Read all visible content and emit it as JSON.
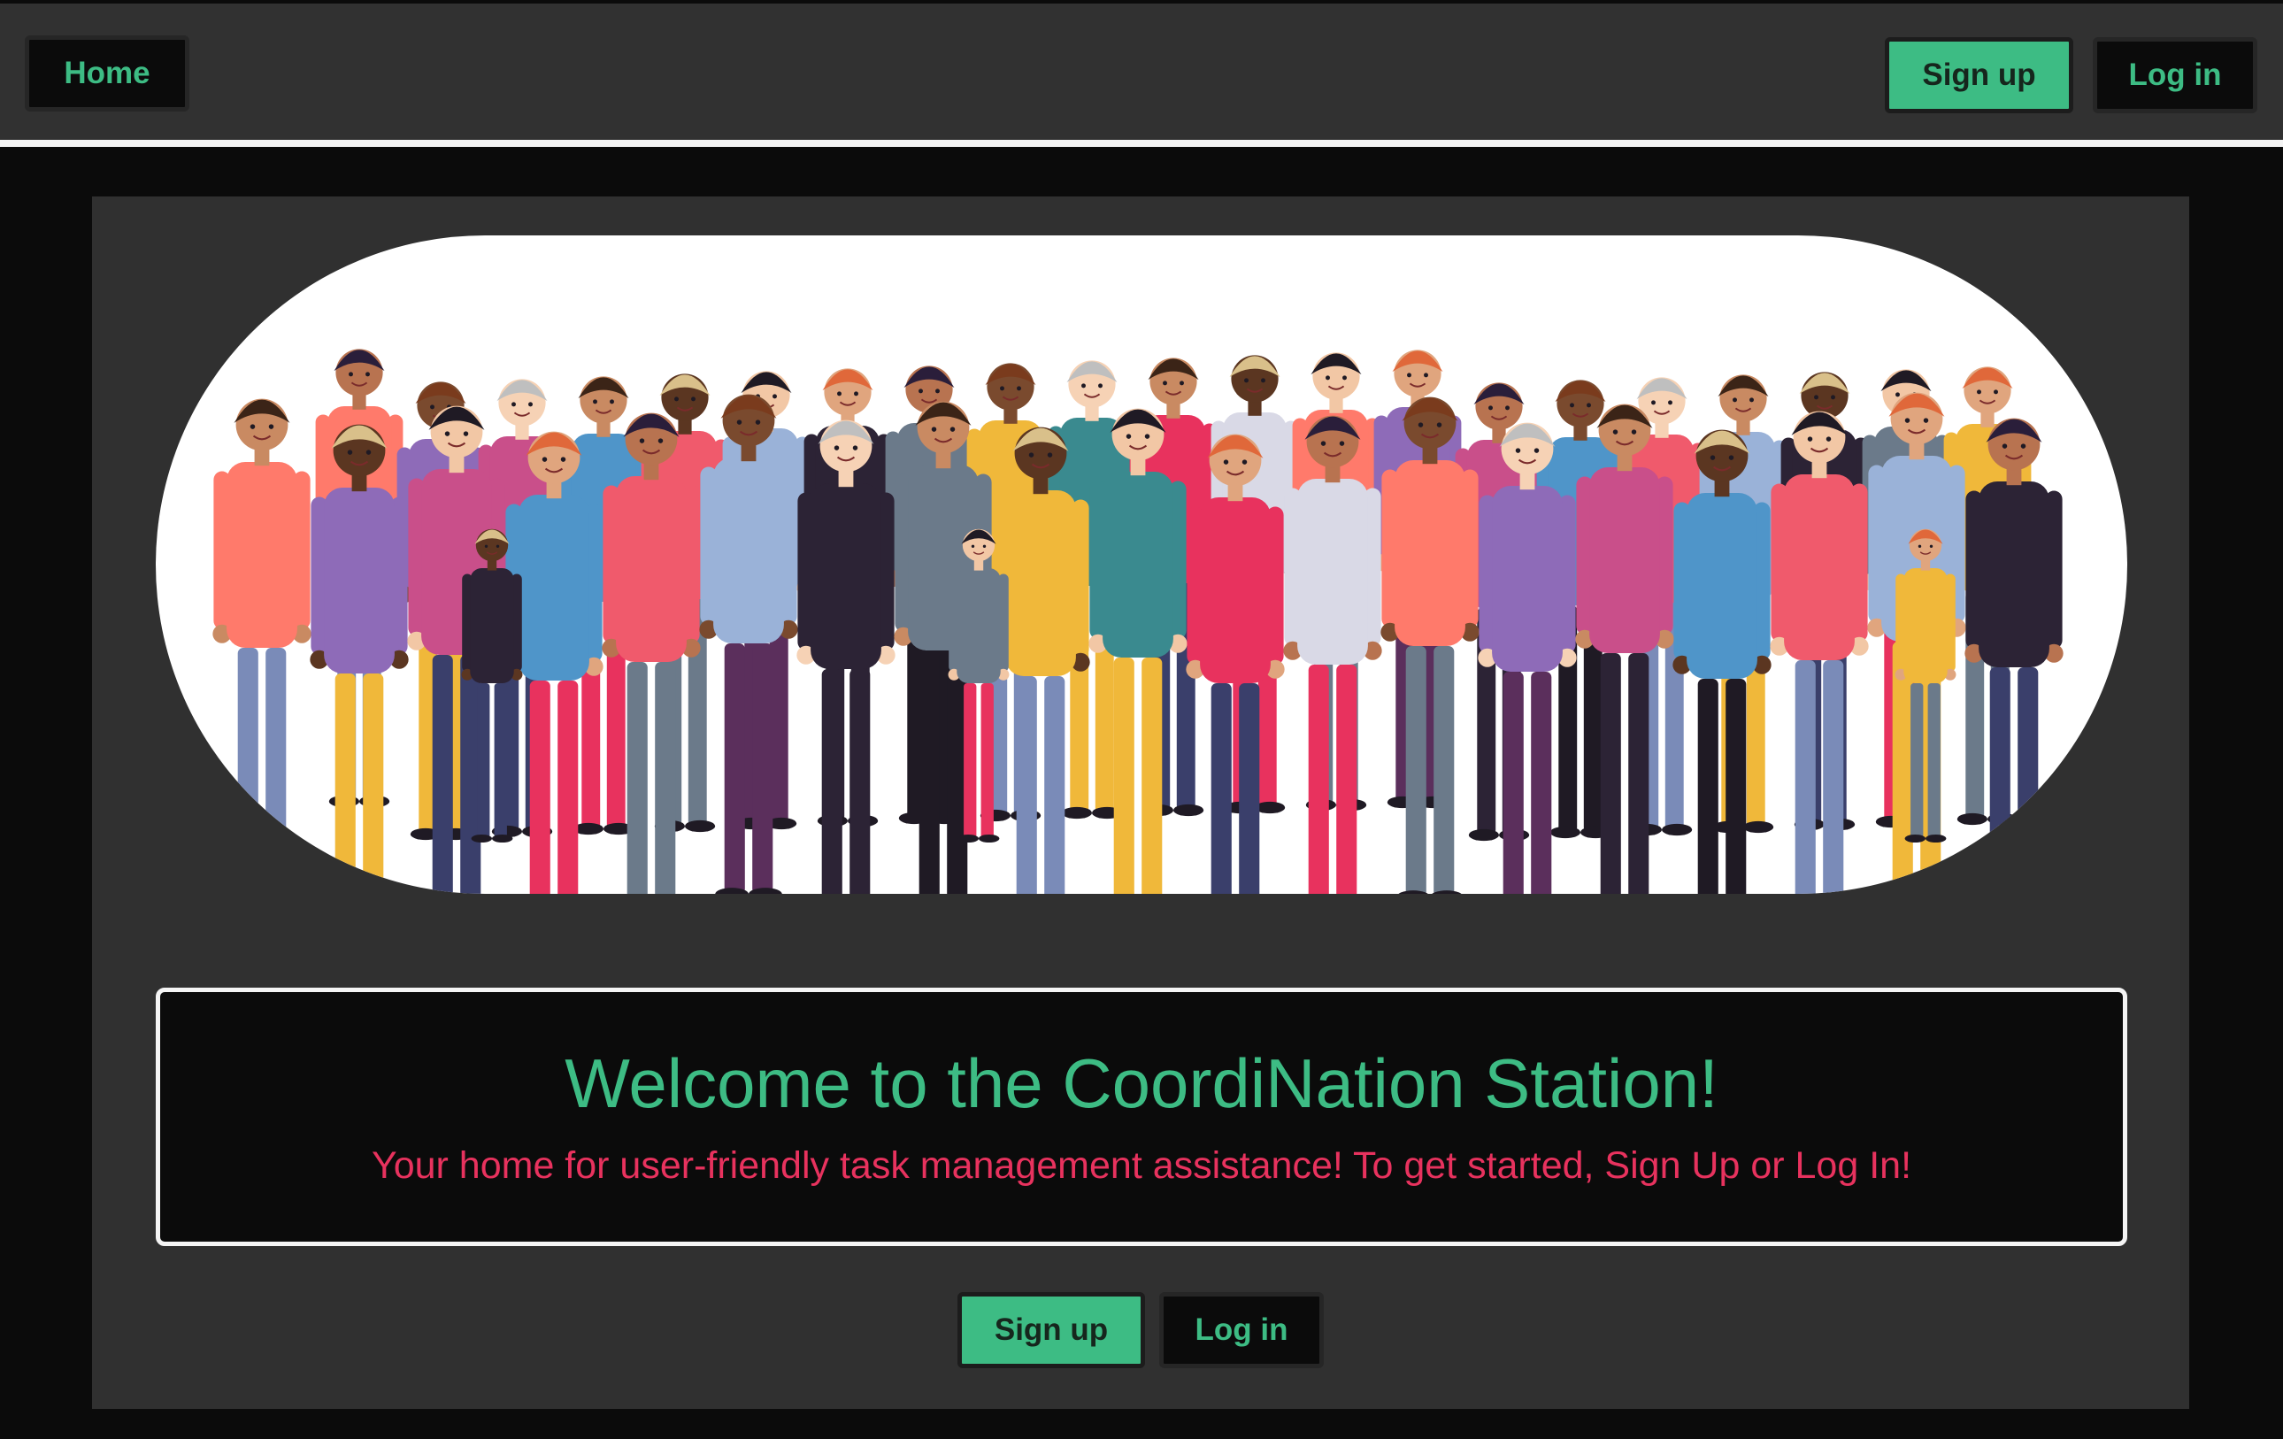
{
  "nav": {
    "home_label": "Home",
    "signup_label": "Sign up",
    "login_label": "Log in"
  },
  "hero": {
    "illustration": "crowd-of-diverse-people"
  },
  "welcome": {
    "title": "Welcome to the CoordiNation Station!",
    "subtitle": "Your home for user-friendly task management assistance! To get started, Sign Up or Log In!"
  },
  "cta": {
    "signup_label": "Sign up",
    "login_label": "Log in"
  },
  "colors": {
    "accent_green": "#3dbc84",
    "accent_pink": "#e8325e",
    "panel_bg": "#303030",
    "page_bg": "#0b0b0b"
  }
}
